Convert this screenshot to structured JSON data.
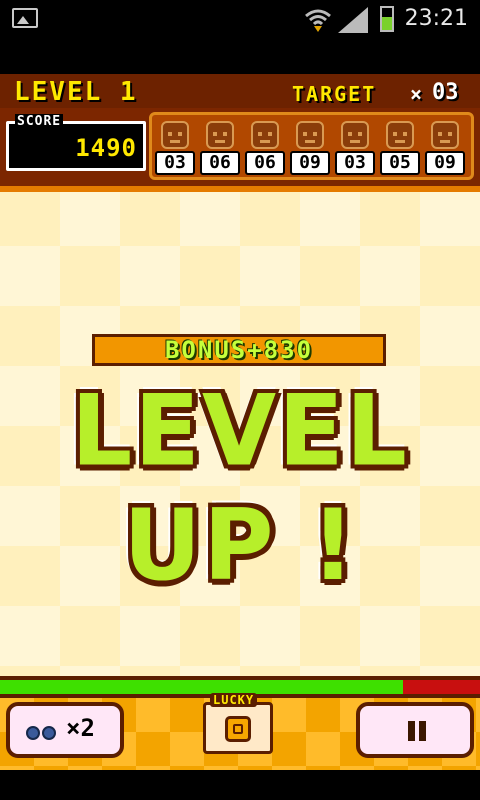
{
  "status_bar": {
    "time": "23:21",
    "icons": [
      "image-icon",
      "wifi-icon",
      "signal-icon",
      "battery-icon"
    ]
  },
  "header": {
    "level_label": "LEVEL 1",
    "target_label": "TARGET",
    "target_multiplier": "×",
    "target_value": "03",
    "score_label": "SCORE",
    "score_value": "1490",
    "targets": [
      {
        "icon": "monkey-icon",
        "count": "03"
      },
      {
        "icon": "owl-icon",
        "count": "06"
      },
      {
        "icon": "deer-icon",
        "count": "06"
      },
      {
        "icon": "hippo-icon",
        "count": "09"
      },
      {
        "icon": "elephant-icon",
        "count": "03"
      },
      {
        "icon": "rabbit-icon",
        "count": "05"
      },
      {
        "icon": "lion-icon",
        "count": "09"
      }
    ]
  },
  "center": {
    "bonus_text": "BONUS+830",
    "level_up_text": "LEVEL UP !"
  },
  "progress": {
    "fill_percent": 84
  },
  "footer": {
    "item_count_prefix": "×",
    "item_count": "2",
    "lucky_label": "LUCKY",
    "pause_label": "II"
  },
  "colors": {
    "header_bg": "#7c2600",
    "accent_yellow": "#ffe800",
    "progress_fill": "#3ee000",
    "progress_track": "#c80f0f",
    "levelup_green": "#b7ef2a"
  }
}
